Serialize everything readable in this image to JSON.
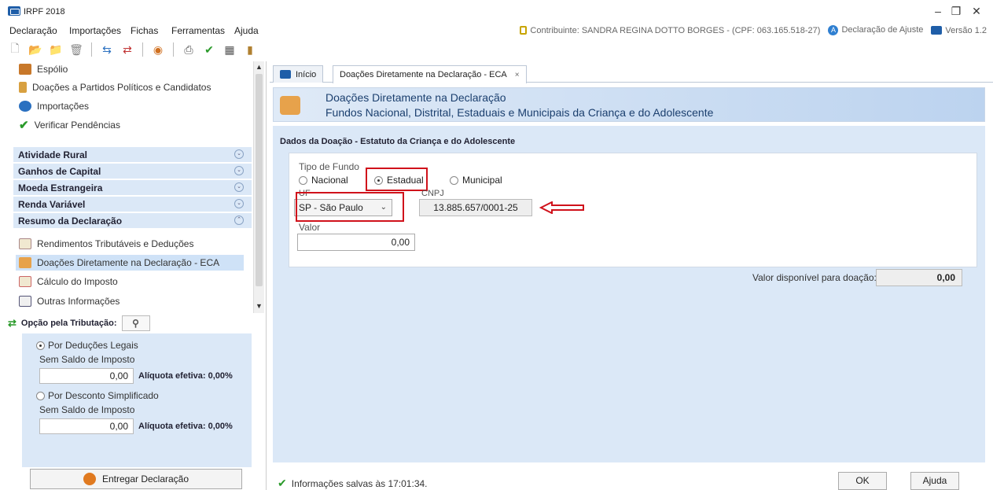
{
  "window": {
    "title": "IRPF 2018",
    "minimize": "–",
    "maximize": "❐",
    "close": "✕"
  },
  "menu": [
    "Declaração",
    "Importações",
    "Fichas",
    "Ferramentas",
    "Ajuda"
  ],
  "header": {
    "contribuinte": "Contribuinte: SANDRA REGINA DOTTO BORGES - (CPF: 063.165.518-27)",
    "declaracao": "Declaração de Ajuste",
    "versao": "Versão 1.2"
  },
  "sidebar": {
    "top_items": [
      {
        "label": "Espólio",
        "icon": "espolio-icon"
      },
      {
        "label": "Doações a Partidos Políticos e Candidatos",
        "icon": "doacoes-partidos-icon"
      },
      {
        "label": "Importações",
        "icon": "importacoes-icon"
      },
      {
        "label": "Verificar Pendências",
        "icon": "check-icon"
      }
    ],
    "categories": [
      "Atividade Rural",
      "Ganhos de Capital",
      "Moeda Estrangeira",
      "Renda Variável",
      "Resumo da Declaração"
    ],
    "resumo_items": [
      {
        "label": "Rendimentos Tributáveis e Deduções",
        "icon": "rendimentos-icon"
      },
      {
        "label": "Doações Diretamente na Declaração - ECA",
        "icon": "doacoes-eca-icon"
      },
      {
        "label": "Cálculo do Imposto",
        "icon": "calculo-icon"
      },
      {
        "label": "Outras Informações",
        "icon": "info-icon"
      }
    ]
  },
  "opcao": {
    "title": "Opção pela Tributação:",
    "deducoes_label": "Por Deduções Legais",
    "deducoes_sub": "Sem Saldo de Imposto",
    "deducoes_valor": "0,00",
    "deducoes_aliquota": "Alíquota efetiva: 0,00%",
    "simplificado_label": "Por Desconto Simplificado",
    "simplificado_sub": "Sem Saldo de Imposto",
    "simplificado_valor": "0,00",
    "simplificado_aliquota": "Alíquota efetiva: 0,00%",
    "entregar": "Entregar Declaração"
  },
  "tabs": [
    {
      "label": "Início"
    },
    {
      "label": "Doações Diretamente na Declaração - ECA",
      "close": "×"
    }
  ],
  "banner": {
    "title": "Doações Diretamente na Declaração",
    "subtitle": "Fundos Nacional, Distrital, Estaduais e Municipais da Criança e do Adolescente"
  },
  "form": {
    "section_title": "Dados da Doação - Estatuto da Criança e do Adolescente",
    "tipo_label": "Tipo de Fundo",
    "tipo_options": [
      "Nacional",
      "Estadual",
      "Municipal"
    ],
    "tipo_selected": "Estadual",
    "uf_label": "UF",
    "uf_value": "SP - São Paulo",
    "cnpj_label": "CNPJ",
    "cnpj_value": "13.885.657/0001-25",
    "valor_label": "Valor",
    "valor_value": "0,00",
    "disponivel_label": "Valor disponível para doação:",
    "disponivel_value": "0,00"
  },
  "status": {
    "text": "Informações salvas às 17:01:34."
  },
  "buttons": {
    "ok": "OK",
    "ajuda": "Ajuda"
  },
  "colors": {
    "highlight_red": "#d0121b",
    "panel_blue": "#dbe8f7",
    "brand_blue": "#1f5ea8"
  }
}
